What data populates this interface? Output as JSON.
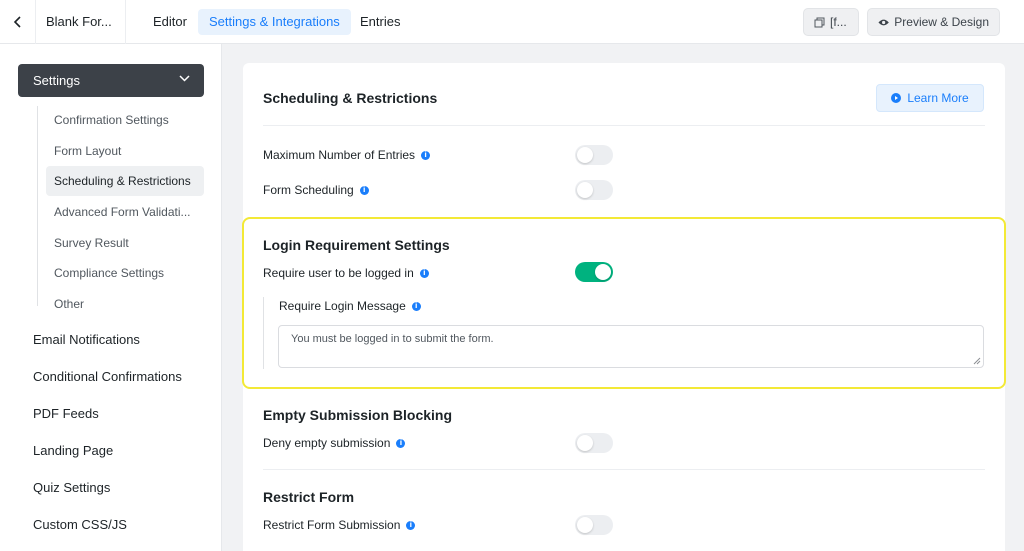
{
  "topbar": {
    "form_name": "Blank For...",
    "nav": [
      {
        "label": "Editor",
        "active": false
      },
      {
        "label": "Settings & Integrations",
        "active": true
      },
      {
        "label": "Entries",
        "active": false
      }
    ],
    "shortcode_label": "[f...",
    "preview_label": "Preview & Design"
  },
  "sidebar": {
    "settings_label": "Settings",
    "sub_items": [
      {
        "label": "Confirmation Settings"
      },
      {
        "label": "Form Layout"
      },
      {
        "label": "Scheduling & Restrictions",
        "active": true
      },
      {
        "label": "Advanced Form Validati..."
      },
      {
        "label": "Survey Result"
      },
      {
        "label": "Compliance Settings"
      },
      {
        "label": "Other"
      }
    ],
    "items": [
      {
        "label": "Email Notifications"
      },
      {
        "label": "Conditional Confirmations"
      },
      {
        "label": "PDF Feeds"
      },
      {
        "label": "Landing Page"
      },
      {
        "label": "Quiz Settings"
      },
      {
        "label": "Custom CSS/JS"
      }
    ]
  },
  "main": {
    "title": "Scheduling & Restrictions",
    "learn_more_label": "Learn More",
    "rows": {
      "max_entries": {
        "label": "Maximum Number of Entries",
        "enabled": false
      },
      "form_scheduling": {
        "label": "Form Scheduling",
        "enabled": false
      }
    },
    "login": {
      "title": "Login Requirement Settings",
      "require_label": "Require user to be logged in",
      "require_enabled": true,
      "message_label": "Require Login Message",
      "message_value": "You must be logged in to submit the form."
    },
    "empty": {
      "title": "Empty Submission Blocking",
      "deny_label": "Deny empty submission",
      "deny_enabled": false
    },
    "restrict": {
      "title": "Restrict Form",
      "restrict_label": "Restrict Form Submission",
      "restrict_enabled": false
    }
  },
  "colors": {
    "accent": "#1a7efb",
    "toggle_on": "#00b27f",
    "highlight": "#f3e936",
    "settings_header_bg": "#3c4148"
  },
  "icons": [
    "chevron-left-icon",
    "copy-icon",
    "eye-icon",
    "chevron-down-icon",
    "play-circle-icon",
    "info-icon",
    "resize-grip-icon"
  ]
}
